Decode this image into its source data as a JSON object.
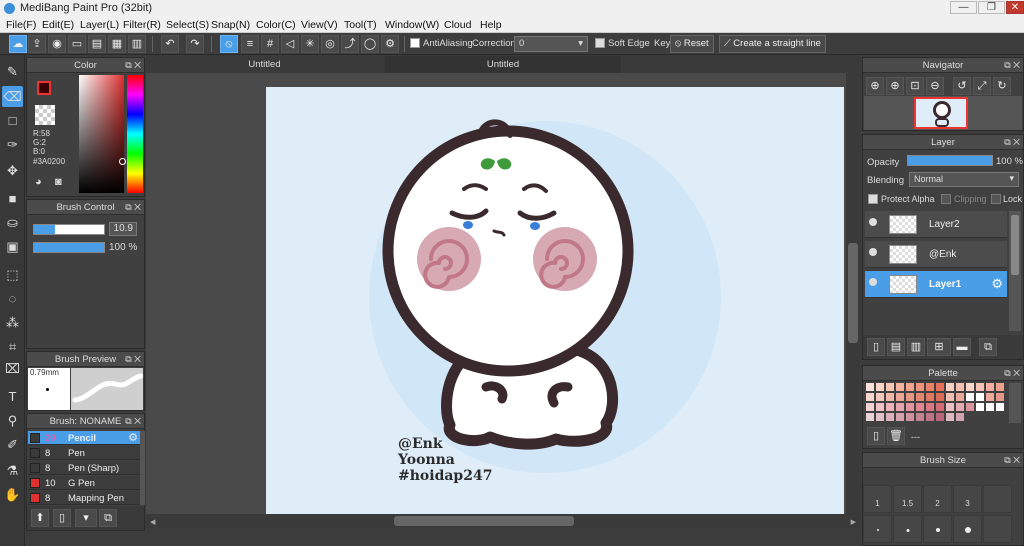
{
  "window": {
    "title": "MediBang Paint Pro (32bit)",
    "minimize": "—",
    "maximize": "❐",
    "close": "✕"
  },
  "menu": [
    "File(F)",
    "Edit(E)",
    "Layer(L)",
    "Filter(R)",
    "Select(S)",
    "Snap(N)",
    "Color(C)",
    "View(V)",
    "Tool(T)",
    "Window(W)",
    "Cloud",
    "Help"
  ],
  "toolbar": {
    "antialiasing": "AntiAliasing",
    "correction_label": "Correction",
    "correction_value": "0",
    "soft_edge": "Soft Edge",
    "key_label": "Key",
    "reset": "Reset",
    "straight_line": "Create a straight line"
  },
  "tabs": [
    "Untitled",
    "Untitled"
  ],
  "color_panel": {
    "title": "Color",
    "r": "R:58",
    "g": "G:2",
    "b": "B:0",
    "hex": "#3A0200",
    "fg": "#3a0200",
    "bg": "#ffffff"
  },
  "brush_control": {
    "title": "Brush Control",
    "size": "10.9",
    "opacity": "100 %",
    "size_fill": 0.3,
    "opacity_fill": 1.0
  },
  "brush_preview": {
    "title": "Brush Preview",
    "size": "0.79mm"
  },
  "brush_list": {
    "title": "Brush: NONAME",
    "items": [
      {
        "size": "29",
        "name": "Pencil",
        "color": "#3a3a3a",
        "selected": true
      },
      {
        "size": "8",
        "name": "Pen",
        "color": "#3a3a3a",
        "selected": false
      },
      {
        "size": "8",
        "name": "Pen (Sharp)",
        "color": "#3a3a3a",
        "selected": false
      },
      {
        "size": "10",
        "name": "G Pen",
        "color": "#e03030",
        "selected": false
      },
      {
        "size": "8",
        "name": "Mapping Pen",
        "color": "#e03030",
        "selected": false
      }
    ]
  },
  "artwork": {
    "watermark_lines": [
      "@Enk",
      "Yoonna",
      "#hoidap247"
    ],
    "colors": {
      "paper": "#deedf8",
      "halo": "#d1e6f6",
      "outline": "#3a2a2e",
      "cheek": "#d7a9b2",
      "leaf": "#3e9a3a",
      "tear": "#3b7ed8"
    }
  },
  "navigator": {
    "title": "Navigator"
  },
  "layer_panel": {
    "title": "Layer",
    "opacity_label": "Opacity",
    "opacity_value": "100 %",
    "opacity_fill": 1.0,
    "blending_label": "Blending",
    "blending_value": "Normal",
    "protect_alpha": "Protect Alpha",
    "clipping": "Clipping",
    "lock": "Lock",
    "layers": [
      {
        "name": "Layer2",
        "selected": false
      },
      {
        "name": "@Enk",
        "selected": false
      },
      {
        "name": "Layer1",
        "selected": true
      }
    ]
  },
  "palette": {
    "title": "Palette",
    "label": "---",
    "swatches": [
      "#fbe3dc",
      "#fbd5c9",
      "#f8c6b6",
      "#f5b4a2",
      "#f2a38e",
      "#ef927a",
      "#eb8168",
      "#e87056",
      "#f7d0c5",
      "#f4bfb2",
      "#fad4cb",
      "#f7c2b6",
      "#f3ae9f",
      "#efa08f",
      "#f6d6cf",
      "#f3c7bd",
      "#f0b6aa",
      "#eda596",
      "#e99583",
      "#e58673",
      "#e17864",
      "#dd6b57",
      "#f0bdb0",
      "#e9a898",
      "#ffffff",
      "#ffffff",
      "#f0a898",
      "#e8968a",
      "#f3d0d4",
      "#f0c1c7",
      "#ecb1b9",
      "#e8a2ab",
      "#e4929d",
      "#e0848f",
      "#dc7682",
      "#d86a76",
      "#ecc0c6",
      "#e4a9b1",
      "#dd939c",
      "#ffffff",
      "#ffffff",
      "#ffffff",
      "#e9d3d9",
      "#e2c2ca",
      "#dbb1bc",
      "#d4a1ad",
      "#cd919f",
      "#c58292",
      "#be7485",
      "#b76779",
      "#dcb8c1",
      "#d1a3ae"
    ]
  },
  "brush_size": {
    "title": "Brush Size",
    "sizes": [
      "1",
      "1.5",
      "2",
      "3"
    ]
  }
}
